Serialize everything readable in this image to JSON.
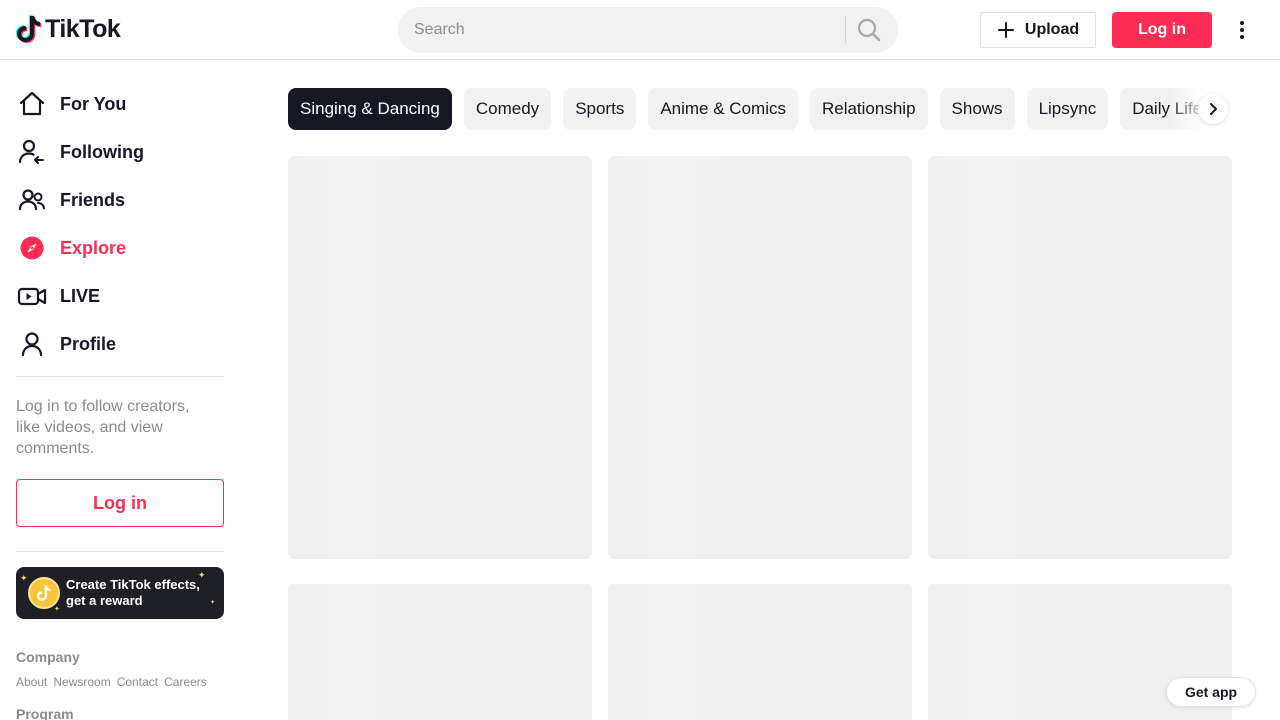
{
  "header": {
    "logo_text": "TikTok",
    "logo_icon": "tiktok-note-icon",
    "search": {
      "placeholder": "Search",
      "value": "",
      "icon": "search-icon"
    },
    "upload_label": "Upload",
    "login_label": "Log in",
    "more_icon": "kebab-menu-icon"
  },
  "sidebar": {
    "nav": [
      {
        "label": "For You",
        "icon": "home-icon",
        "active": false
      },
      {
        "label": "Following",
        "icon": "following-icon",
        "active": false
      },
      {
        "label": "Friends",
        "icon": "friends-icon",
        "active": false
      },
      {
        "label": "Explore",
        "icon": "compass-icon",
        "active": true
      },
      {
        "label": "LIVE",
        "icon": "live-icon",
        "active": false
      },
      {
        "label": "Profile",
        "icon": "profile-icon",
        "active": false
      }
    ],
    "login_hint": "Log in to follow creators, like videos, and view comments.",
    "login_button": "Log in",
    "effects_banner": "Create TikTok effects, get a reward",
    "footer": {
      "company_heading": "Company",
      "company_links": [
        "About",
        "Newsroom",
        "Contact",
        "Careers"
      ],
      "program_heading": "Program"
    }
  },
  "main": {
    "categories": [
      "Singing & Dancing",
      "Comedy",
      "Sports",
      "Anime & Comics",
      "Relationship",
      "Shows",
      "Lipsync",
      "Daily Life"
    ],
    "active_category": "Singing & Dancing"
  },
  "get_app_label": "Get app",
  "colors": {
    "accent": "#fe2c55",
    "text": "#161823",
    "muted": "#8a8b91",
    "placeholder": "#f1f1f2"
  }
}
